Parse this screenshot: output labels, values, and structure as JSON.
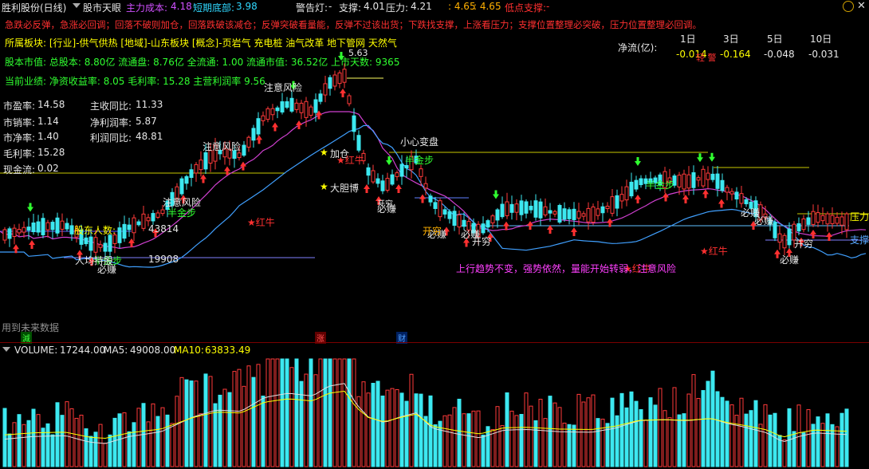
{
  "header": {
    "title": "胜利股份(日线)",
    "indicator": "股市天眼",
    "main_cost_label": "主力成本:",
    "main_cost_value": "4.18",
    "short_bottom_label": "短期底部:",
    "short_bottom_value": "3.98",
    "alert_label": "警告灯:",
    "alert_value": "-",
    "support_label": "支撑:",
    "support_value": "4.01",
    "pressure_label": "压力:",
    "pressure_value": "4.21",
    "range_a": ": 4.65",
    "range_b": ": 4.65",
    "low_support_label": "低点支撑:",
    "low_support_value": "-"
  },
  "motto": "急跌必反弹，急涨必回调；回落不破则加仓，回落跌破该减仓；反弹突破看量能，反弹不过该出货；下跌找支撑，上涨看压力；支撑位置整理必突破，压力位置整理必回调。",
  "info": {
    "sector": "所属板块: [行业]-供气供热 [地域]-山东板块 [概念]-页岩气 充电桩 油气改革 地下管网 天然气",
    "market_value": "股本市值: 总股本: 8.80亿 流通盘: 8.76亿 全流通: 1.00 流通市值: 36.52亿 上市天数: 9365",
    "performance": "当前业绩: 净资收益率: 8.05 毛利率: 15.28 主营利润率 9.56"
  },
  "metrics": {
    "pe_label": "市盈率:",
    "pe": "14.58",
    "ps_label": "市销率:",
    "ps": "1.14",
    "pb_label": "市净率:",
    "pb": "1.40",
    "gross_label": "毛利率:",
    "gross": "15.28",
    "cash_label": "现金流:",
    "cash": "0.02",
    "rev_yoy_label": "主收同比:",
    "rev_yoy": "11.33",
    "net_margin_label": "净利润率:",
    "net_margin": "5.87",
    "profit_yoy_label": "利润同比:",
    "profit_yoy": "48.81"
  },
  "netflow": {
    "label": "净流(亿):",
    "periods": [
      "1日",
      "3日",
      "5日",
      "10日"
    ],
    "values": [
      "-0.014",
      "-0.164",
      "-0.048",
      "-0.031"
    ],
    "overlay": "轻 警"
  },
  "annotations": {
    "high_price": "5.63",
    "risk1": "注意风险",
    "risk2": "注意风险",
    "risk3": "注意风险",
    "careful": "小心变盘",
    "jiacang": "加仓",
    "hongniu1": "红牛",
    "hongniu2": "红牛",
    "hongniu3": "红牛",
    "hongniu4": "红牛",
    "dadanmai": "大胆博",
    "banjinbu1": "半金步",
    "banjinbu2": "半金步",
    "banjinbu3": "半金步",
    "banjinbu4": "半金步",
    "bizhuan": [
      "必赚",
      "必赚",
      "必赚",
      "必赚",
      "必赚",
      "必赚",
      "必赚"
    ],
    "kaiqiong": "开穷",
    "shareholders_label": "股东人数:",
    "shareholders_1": "43814",
    "shareholders_2": "19908",
    "renjun": "人均持股",
    "trend_note": "上行趋势不变，强势依然，量能开始转弱，注意风险",
    "pressure_tag": "压力",
    "support_tag": "支撑",
    "future_data": "用到未来数据"
  },
  "markers": {
    "jian": "減",
    "zhang": "涨",
    "cai": "财"
  },
  "volume": {
    "label": "VOLUME:",
    "value": "17244.00",
    "ma5_label": "MA5:",
    "ma5": "49008.00",
    "ma10_label": "MA10:",
    "ma10": "63833.49"
  },
  "colors": {
    "up": "#ff3a3a",
    "down": "#3ce8f0",
    "ma_purple": "#d040d0",
    "ma_blue": "#40a0ff",
    "yellow": "#ffff00"
  }
}
